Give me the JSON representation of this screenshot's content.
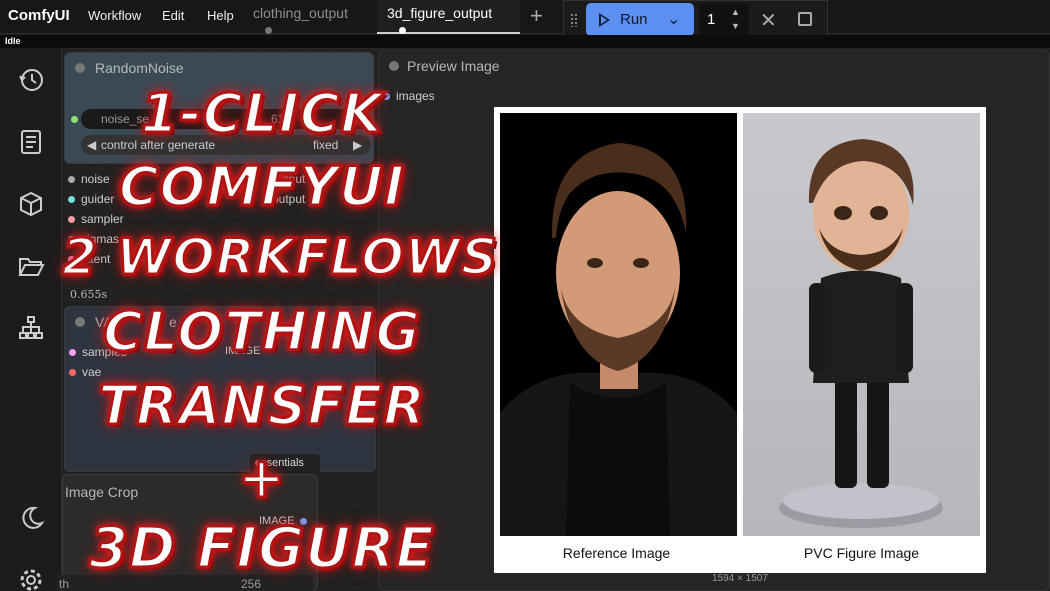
{
  "app": {
    "brand": "ComfyUI",
    "menu": [
      "Workflow",
      "Edit",
      "Help"
    ]
  },
  "tabs": [
    {
      "label": "clothing_output",
      "active": false
    },
    {
      "label": "3d_figure_output",
      "active": true
    }
  ],
  "run": {
    "label": "Run",
    "queue_count": "1"
  },
  "status": "Idle",
  "nodes": {
    "random_noise": {
      "title": "RandomNoise",
      "widgets": {
        "noise_seed_label": "noise_se",
        "noise_seed_value": "616",
        "control_label": "control after generate",
        "control_value": "fixed"
      }
    },
    "sampler_slots": [
      "noise",
      "guider",
      "sampler",
      "sigmas",
      "latent"
    ],
    "sampler_outputs": [
      "output",
      "output"
    ],
    "timing": "0.655s",
    "vae": {
      "title": "VAE",
      "title_tail": "e",
      "slots": [
        "samples",
        "vae"
      ],
      "output": "IMAGE"
    },
    "badge": "essentials",
    "image_crop": {
      "title": "Image Crop",
      "output": "IMAGE",
      "field_label": "th",
      "field_value": "256"
    }
  },
  "preview": {
    "title": "Preview Image",
    "input": "images",
    "captions": [
      "Reference Image",
      "PVC Figure Image"
    ],
    "dimensions": "1594 × 1507"
  },
  "overlay_text": [
    "1-CLICK",
    "COMFYUI",
    "2 WORKFLOWS",
    "CLOTHING",
    "TRANSFER",
    "+",
    "3D FIGURE"
  ],
  "colors": {
    "run_button": "#5b8ff2",
    "overlay_glow": "#e02020",
    "slot_noise": "#aaaaaa",
    "slot_guider": "#6ee0e0",
    "slot_sampler": "#f0a0a0",
    "slot_vae": "#ff6b6b",
    "slot_samples": "#ff9ff3"
  }
}
